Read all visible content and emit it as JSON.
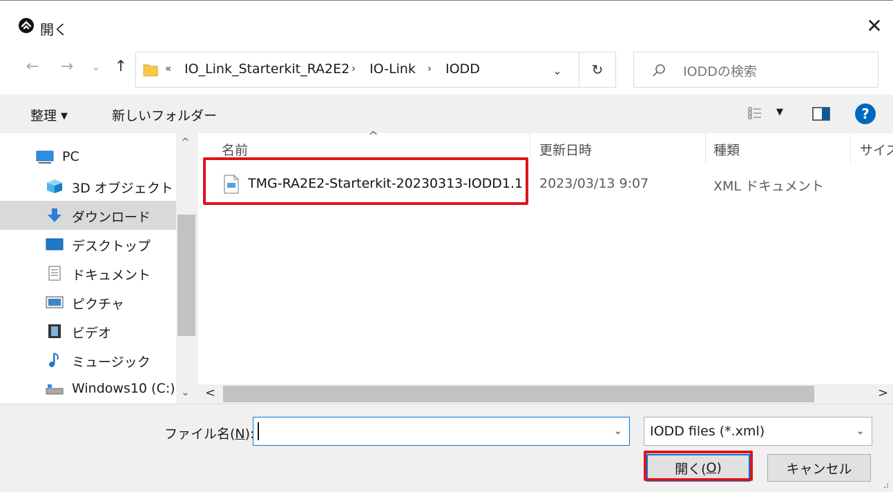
{
  "window": {
    "title": "開く",
    "close_glyph": "✕"
  },
  "nav": {
    "back_glyph": "←",
    "forward_glyph": "→",
    "recent_glyph": "⌄",
    "up_glyph": "↑",
    "refresh_glyph": "↻"
  },
  "address": {
    "overflow_glyph": "«",
    "crumbs": [
      "IO_Link_Starterkit_RA2E2",
      "IO-Link",
      "IODD"
    ],
    "separator": "›",
    "dropdown_glyph": "⌄"
  },
  "search": {
    "placeholder": "IODDの検索"
  },
  "toolbar": {
    "organize_label": "整理",
    "new_folder_label": "新しいフォルダー",
    "caret": "▼",
    "help_label": "?"
  },
  "sidebar": {
    "items": [
      {
        "label": "PC",
        "icon": "pc-icon"
      },
      {
        "label": "3D オブジェクト",
        "icon": "3d-objects-icon"
      },
      {
        "label": "ダウンロード",
        "icon": "download-icon",
        "selected": true
      },
      {
        "label": "デスクトップ",
        "icon": "desktop-icon"
      },
      {
        "label": "ドキュメント",
        "icon": "documents-icon"
      },
      {
        "label": "ピクチャ",
        "icon": "pictures-icon"
      },
      {
        "label": "ビデオ",
        "icon": "videos-icon"
      },
      {
        "label": "ミュージック",
        "icon": "music-icon"
      },
      {
        "label": "Windows10 (C:)",
        "icon": "drive-icon"
      }
    ],
    "scroll_up_glyph": "^",
    "scroll_down_glyph": "⌄"
  },
  "filelist": {
    "sort_glyph": "^",
    "columns": [
      "名前",
      "更新日時",
      "種類",
      "サイズ"
    ],
    "rows": [
      {
        "name": "TMG-RA2E2-Starterkit-20230313-IODD1.1",
        "modified": "2023/03/13 9:07",
        "type": "XML ドキュメント",
        "icon": "xml-file-icon"
      }
    ],
    "scroll_left_glyph": "<",
    "scroll_right_glyph": ">"
  },
  "bottom": {
    "filename_label_pre": "ファイル名(",
    "filename_label_key": "N",
    "filename_label_post": "):",
    "filename_value": "",
    "filename_dropdown_glyph": "⌄",
    "filter_value": "IODD files (*.xml)",
    "filter_dropdown_glyph": "⌄",
    "open_label_pre": "開く(",
    "open_label_key": "O",
    "open_label_post": ")",
    "cancel_label": "キャンセル"
  },
  "colors": {
    "highlight": "#e0121b",
    "accent": "#0078d7",
    "help_blue": "#0067c0"
  }
}
